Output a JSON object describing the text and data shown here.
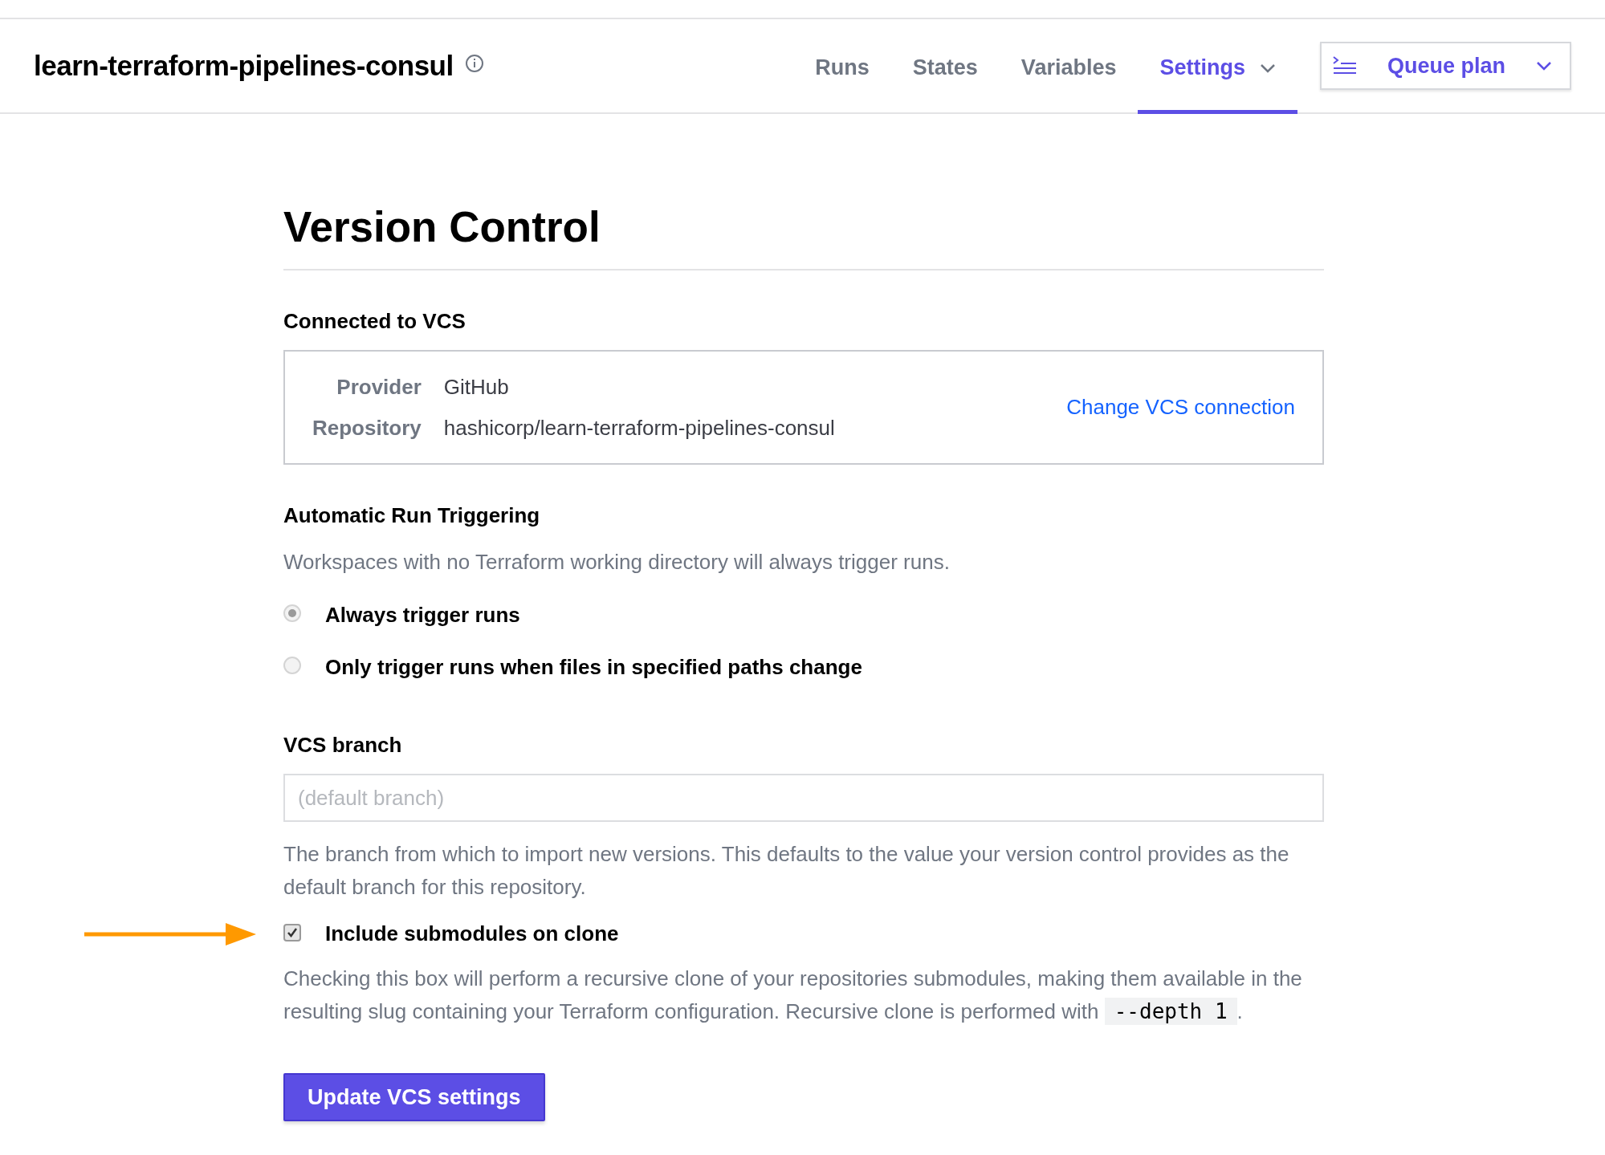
{
  "header": {
    "title": "learn-terraform-pipelines-consul",
    "tabs": [
      {
        "label": "Runs",
        "selected": false
      },
      {
        "label": "States",
        "selected": false
      },
      {
        "label": "Variables",
        "selected": false
      },
      {
        "label": "Settings",
        "selected": true,
        "dropdown": true
      }
    ],
    "action": {
      "label": "Queue plan"
    }
  },
  "page": {
    "title": "Version Control",
    "connection": {
      "heading": "Connected to VCS",
      "fields": [
        {
          "label": "Provider",
          "value": "GitHub"
        },
        {
          "label": "Repository",
          "value": "hashicorp/learn-terraform-pipelines-consul"
        }
      ],
      "link": "Change VCS connection"
    },
    "triggering": {
      "heading": "Automatic Run Triggering",
      "description": "Workspaces with no Terraform working directory will always trigger runs.",
      "options": [
        {
          "label": "Always trigger runs",
          "selected": true
        },
        {
          "label": "Only trigger runs when files in specified paths change",
          "selected": false
        }
      ]
    },
    "branch": {
      "label": "VCS branch",
      "placeholder": "(default branch)",
      "help": "The branch from which to import new versions. This defaults to the value your version control provides as the default branch for this repository."
    },
    "submodules": {
      "label": "Include submodules on clone",
      "checked": true,
      "help": "Checking this box will perform a recursive clone of your repositories submodules, making them available in the resulting slug containing your Terraform configuration. Recursive clone is performed with",
      "code": "--depth 1",
      "after": "."
    },
    "submit": "Update VCS settings"
  }
}
